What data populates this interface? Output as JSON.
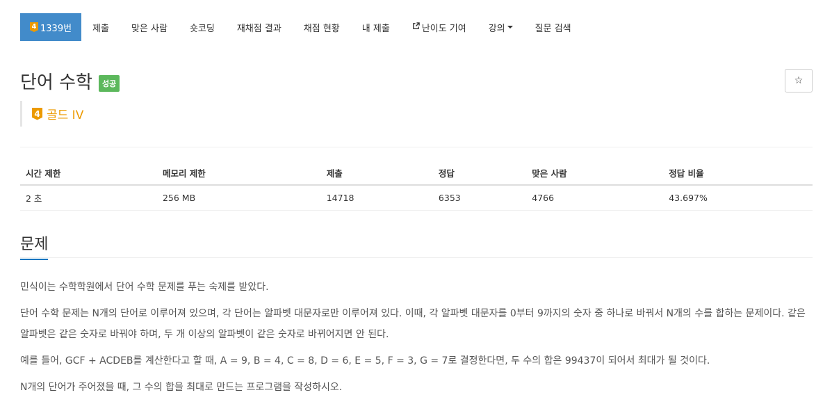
{
  "nav": {
    "tier_label": "4",
    "problem_number": "1339번",
    "items": [
      "제출",
      "맞은 사람",
      "숏코딩",
      "재채점 결과",
      "채점 현황",
      "내 제출"
    ],
    "difficulty_contrib": "난이도 기여",
    "lecture": "강의",
    "search": "질문 검색"
  },
  "problem": {
    "title": "단어 수학",
    "status": "성공",
    "tier_number": "4",
    "tier_name": "골드 IV",
    "star": "☆"
  },
  "table": {
    "headers": [
      "시간 제한",
      "메모리 제한",
      "제출",
      "정답",
      "맞은 사람",
      "정답 비율"
    ],
    "values": [
      "2 초",
      "256 MB",
      "14718",
      "6353",
      "4766",
      "43.697%"
    ]
  },
  "section": {
    "title": "문제"
  },
  "description": [
    "민식이는 수학학원에서 단어 수학 문제를 푸는 숙제를 받았다.",
    "단어 수학 문제는 N개의 단어로 이루어져 있으며, 각 단어는 알파벳 대문자로만 이루어져 있다. 이때, 각 알파벳 대문자를 0부터 9까지의 숫자 중 하나로 바꿔서 N개의 수를 합하는 문제이다. 같은 알파벳은 같은 숫자로 바꿔야 하며, 두 개 이상의 알파벳이 같은 숫자로 바뀌어지면 안 된다.",
    "예를 들어, GCF + ACDEB를 계산한다고 할 때, A = 9, B = 4, C = 8, D = 6, E = 5, F = 3, G = 7로 결정한다면, 두 수의 합은 99437이 되어서 최대가 될 것이다.",
    "N개의 단어가 주어졌을 때, 그 수의 합을 최대로 만드는 프로그램을 작성하시오."
  ],
  "colors": {
    "nav_active": "#428bca",
    "success": "#5cb85c",
    "gold": "#ec9a00",
    "section_underline": "#0076c0"
  }
}
